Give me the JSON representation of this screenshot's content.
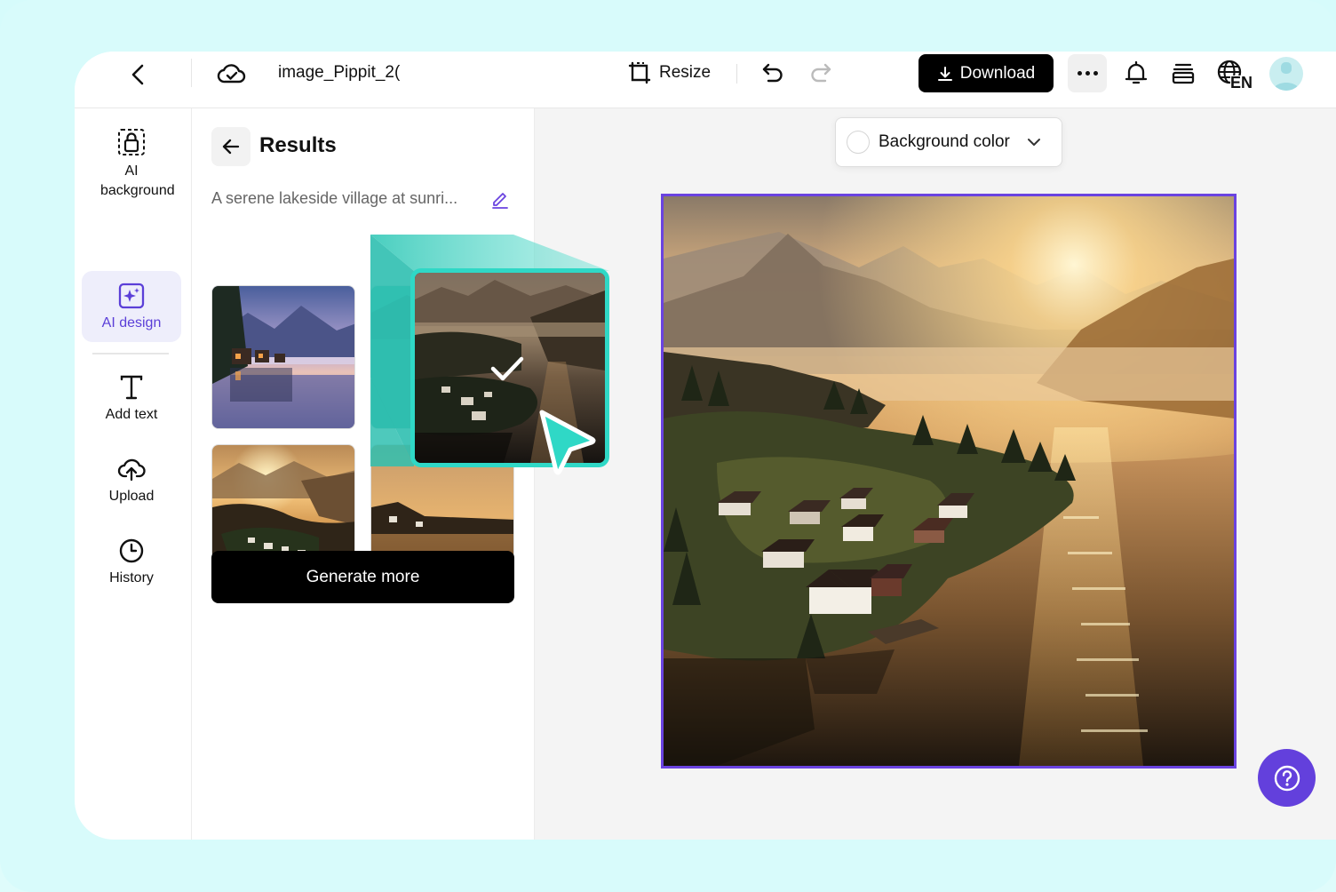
{
  "topbar": {
    "filename": "image_Pippit_2(",
    "resize_label": "Resize",
    "download_label": "Download",
    "language_code": "EN"
  },
  "rail": {
    "items": [
      {
        "label": "AI background",
        "icon": "lock-dashed-icon"
      },
      {
        "label": "AI design",
        "icon": "sparkle-image-icon",
        "active": true
      },
      {
        "label": "Add text",
        "icon": "text-icon"
      },
      {
        "label": "Upload",
        "icon": "cloud-upload-icon"
      },
      {
        "label": "History",
        "icon": "clock-icon"
      }
    ]
  },
  "results": {
    "title": "Results",
    "prompt": "A serene lakeside village at sunri...",
    "generate_label": "Generate more"
  },
  "canvas": {
    "background_color_label": "Background color"
  },
  "colors": {
    "accent": "#6a43e0",
    "highlight": "#2fd8c6",
    "frame": "#d8fbfb"
  }
}
